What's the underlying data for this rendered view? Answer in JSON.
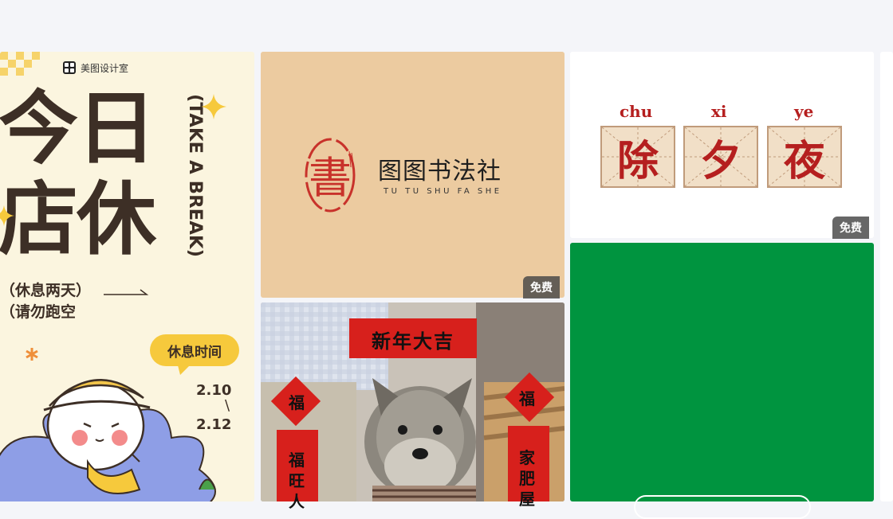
{
  "page": {
    "background": "#f4f5f9"
  },
  "cards": {
    "poster_closed": {
      "brand": "美图设计室",
      "title_line1": "今日",
      "title_line2": "店休",
      "vertical_text": "(TAKE A BREAK)",
      "sub_line1": "（休息两天）",
      "sub_line2": "（请勿跑空",
      "bubble": "休息时间",
      "date_start": "2.10",
      "date_sep": "\\",
      "date_end": "2.12",
      "colors": {
        "bg": "#fbf5df",
        "ink": "#3d2f26",
        "accent": "#f6c93c"
      }
    },
    "calligraphy_club": {
      "seal_char": "書",
      "name": "图图书法社",
      "pinyin": "TU TU SHU FA SHE",
      "badge": "免费",
      "colors": {
        "bg": "#eccba0",
        "seal": "#c8322b"
      }
    },
    "new_year_eve": {
      "pinyin": [
        "chu",
        "xi",
        "ye"
      ],
      "chars": [
        "除",
        "夕",
        "夜"
      ],
      "badge": "免费",
      "colors": {
        "red": "#b51f1f",
        "grid_bg": "#f1dfc7"
      }
    },
    "dog_new_year": {
      "banner": "新年大吉",
      "fu_left": "福",
      "fu_right": "福",
      "couplet_left": "福旺人",
      "couplet_right": "家肥屋",
      "colors": {
        "red": "#d7201c"
      }
    },
    "green_card": {
      "colors": {
        "bg": "#00943f"
      }
    }
  },
  "icons": [
    "sparkle-icon",
    "brand-logo-icon",
    "arrow-line-icon"
  ]
}
